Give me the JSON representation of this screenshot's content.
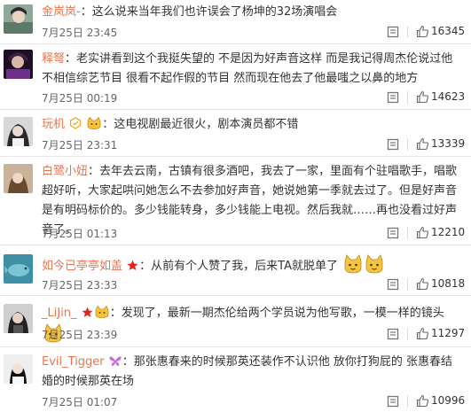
{
  "comments": [
    {
      "user": "金岚岚-",
      "text": "这么说来当年我们也许误会了杨坤的32场演唱会",
      "time": "7月25日 23:45",
      "likes": "16345"
    },
    {
      "user": "释弩",
      "text": "老实讲看到这个我挺失望的 不是因为好声音这样 而是我记得周杰伦说过他不相信综艺节目 很看不起作假的节目 然而现在他去了他最嗤之以鼻的地方",
      "time": "7月25日 00:19",
      "likes": "14623"
    },
    {
      "user": "玩机",
      "text": "这电视剧最近很火，剧本演员都不错",
      "time": "7月25日 23:31",
      "likes": "13339"
    },
    {
      "user": "白鹭小妞",
      "text": "去年去云南，古镇有很多酒吧，我去了一家，里面有个驻唱歌手，唱歌超好听，大家起哄问她怎么不去参加好声音，她说她第一季就去过了。但是好声音是有明码标价的。多少钱能转身，多少钱能上电视。然后我就……再也没看过好声音了。",
      "time": "7月25日 01:13",
      "likes": "12210"
    },
    {
      "user": "如今已亭亭如盖",
      "text": "从前有个人赞了我，后来TA就脱单了",
      "time": "7月25日 23:33",
      "likes": "10818"
    },
    {
      "user": "_LiJin_",
      "text": "发现了，最新一期杰伦给两个学员说为他写歌，一模一样的镜头",
      "time": "7月25日 23:39",
      "likes": "11297"
    },
    {
      "user": "Evil_Tigger",
      "text": "那张惠春来的时候那英还装作不认识他 放你打狗屁的 张惠春结婚的时候那英在场",
      "time": "7月25日 01:07",
      "likes": "10996"
    }
  ],
  "colors": {
    "username": "#eb7350",
    "text": "#333333",
    "meta": "#666666",
    "divider": "#e6e6e6"
  }
}
